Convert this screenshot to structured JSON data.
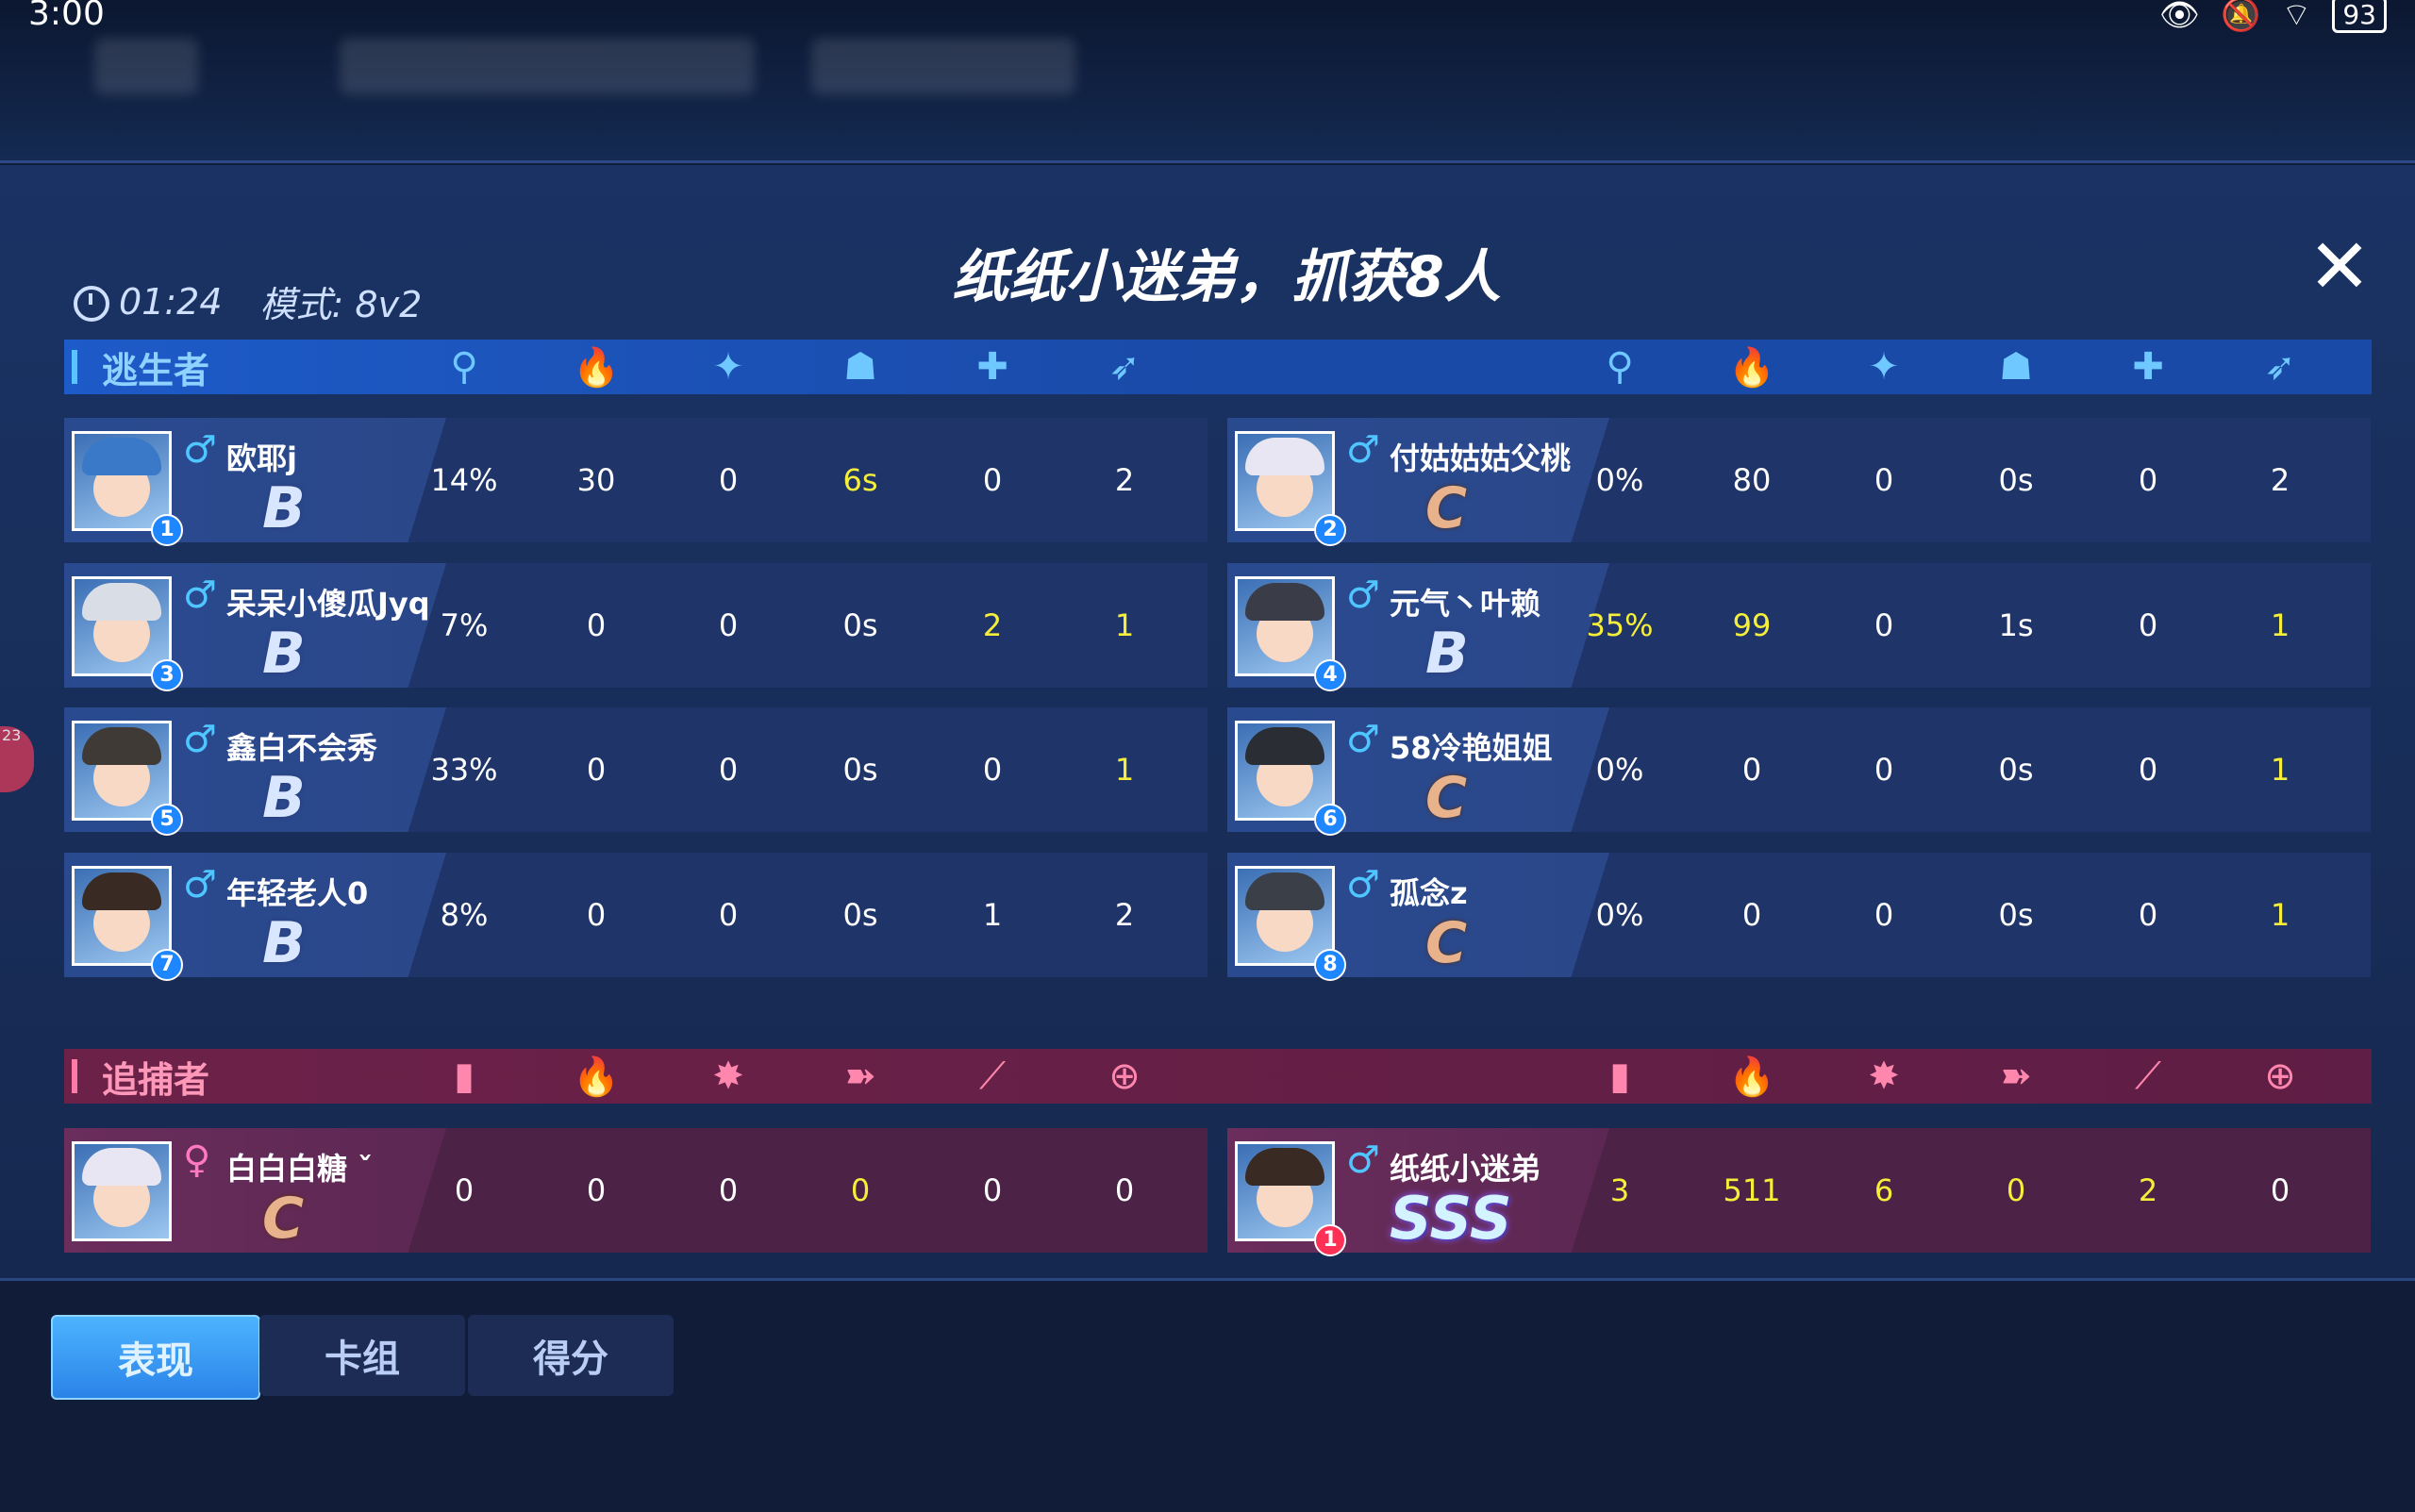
{
  "status_bar": {
    "time": "3:00",
    "icons": [
      "eye-icon",
      "mute-bell-icon",
      "wifi-icon"
    ],
    "battery": "93"
  },
  "header": {
    "match_time": "01:24",
    "mode_label": "模式: 8v2",
    "title": "纸纸小迷弟，抓获8人",
    "close": "✕"
  },
  "escapees": {
    "label": "逃生者",
    "column_icons": [
      "key-icon",
      "flame-icon",
      "rescue-icon",
      "shield-person-icon",
      "medkit-icon",
      "runner-icon"
    ],
    "rows": [
      {
        "left": {
          "name": "欧耶j",
          "num": "1",
          "gender": "♂",
          "grade": "B",
          "stats": [
            "14%",
            "30",
            "0",
            "6s",
            "0",
            "2"
          ],
          "hl": [
            false,
            false,
            false,
            true,
            false,
            false
          ]
        },
        "right": {
          "name": "付姑姑姑父桃",
          "num": "2",
          "gender": "♂",
          "grade": "C",
          "stats": [
            "0%",
            "80",
            "0",
            "0s",
            "0",
            "2"
          ],
          "hl": [
            false,
            false,
            false,
            false,
            false,
            false
          ]
        }
      },
      {
        "left": {
          "name": "呆呆小傻瓜Jyq",
          "num": "3",
          "gender": "♂",
          "grade": "B",
          "stats": [
            "7%",
            "0",
            "0",
            "0s",
            "2",
            "1"
          ],
          "hl": [
            false,
            false,
            false,
            false,
            true,
            true
          ]
        },
        "right": {
          "name": "元气丶叶赖",
          "num": "4",
          "gender": "♂",
          "grade": "B",
          "stats": [
            "35%",
            "99",
            "0",
            "1s",
            "0",
            "1"
          ],
          "hl": [
            true,
            true,
            false,
            false,
            false,
            true
          ]
        }
      },
      {
        "left": {
          "name": "鑫白不会秀",
          "num": "5",
          "gender": "♂",
          "grade": "B",
          "stats": [
            "33%",
            "0",
            "0",
            "0s",
            "0",
            "1"
          ],
          "hl": [
            false,
            false,
            false,
            false,
            false,
            true
          ]
        },
        "right": {
          "name": "58冷艳姐姐",
          "num": "6",
          "gender": "♂",
          "grade": "C",
          "stats": [
            "0%",
            "0",
            "0",
            "0s",
            "0",
            "1"
          ],
          "hl": [
            false,
            false,
            false,
            false,
            false,
            true
          ]
        }
      },
      {
        "left": {
          "name": "年轻老人0",
          "num": "7",
          "gender": "♂",
          "grade": "B",
          "stats": [
            "8%",
            "0",
            "0",
            "0s",
            "1",
            "2"
          ],
          "hl": [
            false,
            false,
            false,
            false,
            false,
            false
          ]
        },
        "right": {
          "name": "孤念z",
          "num": "8",
          "gender": "♂",
          "grade": "C",
          "stats": [
            "0%",
            "0",
            "0",
            "0s",
            "0",
            "1"
          ],
          "hl": [
            false,
            false,
            false,
            false,
            false,
            true
          ]
        }
      }
    ]
  },
  "hunters": {
    "label": "追捕者",
    "column_icons": [
      "door-icon",
      "flame-icon",
      "knockdown-icon",
      "dash-icon",
      "claw-icon",
      "target-icon"
    ],
    "row": {
      "left": {
        "name": "白白白糖 ˇ",
        "num": "",
        "gender": "♀",
        "grade": "C",
        "stats": [
          "0",
          "0",
          "0",
          "0",
          "0",
          "0"
        ],
        "hl": [
          false,
          false,
          false,
          true,
          false,
          false
        ]
      },
      "right": {
        "name": "纸纸小迷弟",
        "num": "1",
        "gender": "♂",
        "grade": "SSS",
        "stats": [
          "3",
          "511",
          "6",
          "0",
          "2",
          "0"
        ],
        "hl": [
          true,
          true,
          true,
          true,
          true,
          false
        ]
      }
    }
  },
  "tabs": [
    "表现",
    "卡组",
    "得分"
  ],
  "side_notification": "23",
  "colors": {
    "highlight": "#f5ef3a",
    "escapee_bar": "#1d5bc8",
    "hunter_bar": "#6c2148"
  }
}
